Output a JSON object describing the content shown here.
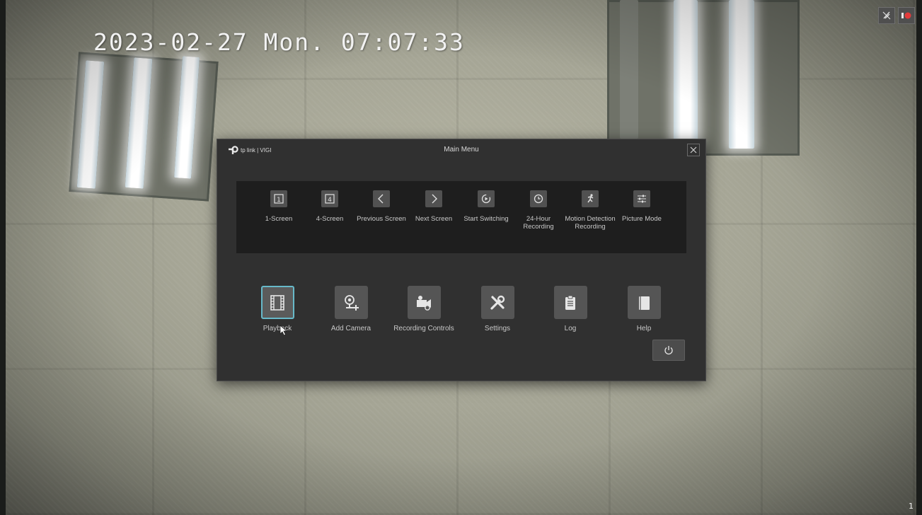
{
  "osd": {
    "timestamp": "2023-02-27 Mon. 07:07:33",
    "channel": "1"
  },
  "top_icons": [
    "audio-muted-icon",
    "record-icon"
  ],
  "dialog": {
    "brand": "tp link | VIGI",
    "title": "Main Menu",
    "close_icon": "close-icon"
  },
  "quick_actions": [
    {
      "label": "1-Screen",
      "icon": "one-screen-icon"
    },
    {
      "label": "4-Screen",
      "icon": "four-screen-icon"
    },
    {
      "label": "Previous Screen",
      "icon": "chevron-left-icon"
    },
    {
      "label": "Next Screen",
      "icon": "chevron-right-icon"
    },
    {
      "label": "Start Switching",
      "icon": "switching-icon"
    },
    {
      "label": "24-Hour\nRecording",
      "icon": "clock-icon"
    },
    {
      "label": "Motion Detection\nRecording",
      "icon": "running-person-icon"
    },
    {
      "label": "Picture Mode",
      "icon": "sliders-icon"
    }
  ],
  "main_items": [
    {
      "label": "Playback",
      "icon": "film-icon",
      "active": true
    },
    {
      "label": "Add Camera",
      "icon": "add-camera-icon",
      "active": false
    },
    {
      "label": "Recording Controls",
      "icon": "video-camera-settings-icon",
      "active": false
    },
    {
      "label": "Settings",
      "icon": "tools-icon",
      "active": false
    },
    {
      "label": "Log",
      "icon": "clipboard-icon",
      "active": false
    },
    {
      "label": "Help",
      "icon": "book-icon",
      "active": false
    }
  ],
  "power_icon": "power-icon",
  "colors": {
    "dialog_bg": "#303030",
    "panel_bg": "#1e1e1e",
    "active_border": "#67b9c9",
    "record_red": "#e23b3b"
  }
}
